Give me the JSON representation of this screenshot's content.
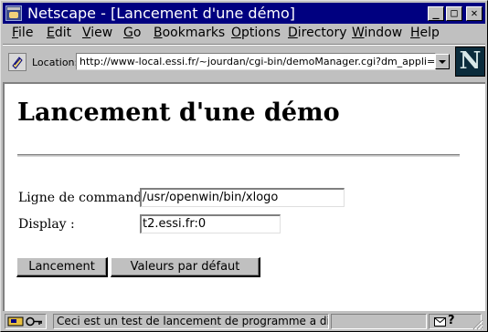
{
  "window": {
    "title": "Netscape - [Lancement d'une démo]",
    "controls": {
      "minimize": "_",
      "maximize": "□",
      "close": "✕"
    }
  },
  "menu": {
    "items": [
      {
        "label": "File",
        "mnemonic": "F",
        "rest": "ile"
      },
      {
        "label": "Edit",
        "mnemonic": "E",
        "rest": "dit"
      },
      {
        "label": "View",
        "mnemonic": "V",
        "rest": "iew"
      },
      {
        "label": "Go",
        "mnemonic": "G",
        "rest": "o"
      },
      {
        "label": "Bookmarks",
        "mnemonic": "B",
        "rest": "ookmarks"
      },
      {
        "label": "Options",
        "mnemonic": "O",
        "rest": "ptions"
      },
      {
        "label": "Directory",
        "mnemonic": "D",
        "rest": "irectory"
      },
      {
        "label": "Window",
        "mnemonic": "W",
        "rest": "indow"
      },
      {
        "label": "Help",
        "mnemonic": "H",
        "rest": "elp"
      }
    ]
  },
  "location": {
    "label": "Location:",
    "url": "http://www-local.essi.fr/~jourdan/cgi-bin/demoManager.cgi?dm_appli=dm_test",
    "logo": "N"
  },
  "page": {
    "title": "Lancement d'une démo",
    "form": {
      "command_label": "Ligne de commande :",
      "command_value": "/usr/openwin/bin/xlogo",
      "display_label": "Display :",
      "display_value": "t2.essi.fr:0",
      "launch_button": "Lancement",
      "reset_button": "Valeurs par défaut"
    }
  },
  "status": {
    "message": "Ceci est un test de lancement de programme a distance",
    "help_glyph": "?"
  },
  "icons": {
    "app": "netscape-app-icon",
    "location": "bookmark-link-icon",
    "security": "security-key-icon",
    "mail": "mail-icon"
  }
}
